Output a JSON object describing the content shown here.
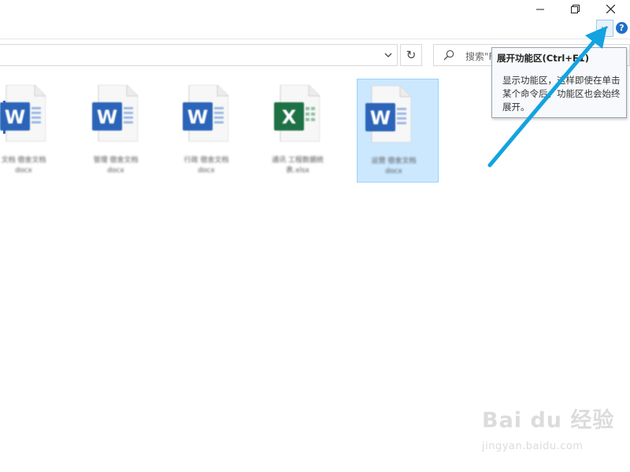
{
  "window": {
    "minimize_icon": "minimize-icon",
    "restore_icon": "restore-icon",
    "close_icon": "close-icon"
  },
  "ribbon": {
    "expand_icon": "chevron-down-icon",
    "help_label": "?"
  },
  "address_bar": {
    "refresh_glyph": "↻"
  },
  "search": {
    "placeholder": "搜索\"F"
  },
  "tooltip": {
    "title": "展开功能区(Ctrl+F1)",
    "body": "显示功能区，这样即使在单击某个命令后，功能区也会始终展开。"
  },
  "files": [
    {
      "type": "word",
      "name": "",
      "selected": false
    },
    {
      "type": "word",
      "name": "",
      "selected": false
    },
    {
      "type": "word",
      "name": "",
      "selected": false
    },
    {
      "type": "excel",
      "name": "",
      "selected": false
    },
    {
      "type": "word",
      "name": "",
      "selected": true
    }
  ],
  "colors": {
    "word": "#2b64b8",
    "excel": "#1e7145",
    "arrow": "#12a3e0",
    "selection": "#cce8ff"
  },
  "watermark": {
    "logo": "Bai du 经验",
    "url": "jingyan.baidu.com"
  }
}
